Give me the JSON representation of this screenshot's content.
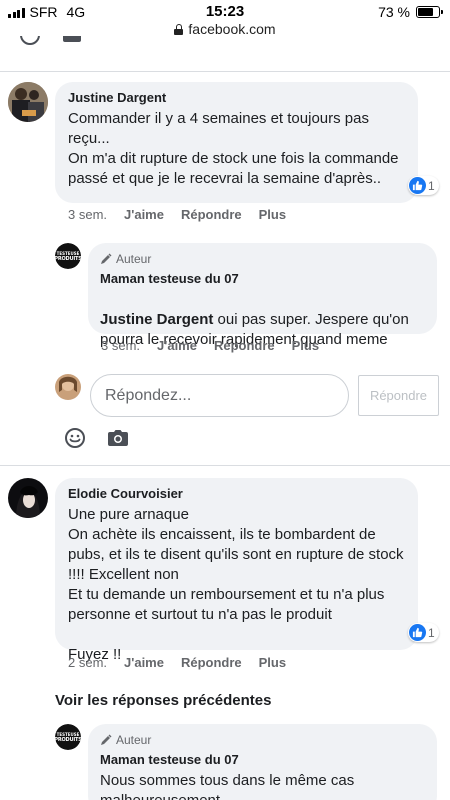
{
  "status_bar": {
    "carrier": "SFR",
    "network": "4G",
    "time": "15:23",
    "battery": "73 %",
    "battery_level": 0.73
  },
  "browser": {
    "url": "facebook.com"
  },
  "colors": {
    "accent": "#1877f2",
    "bubble_bg": "#f0f2f5",
    "meta_text": "#65676b"
  },
  "comments": [
    {
      "author": "Justine Dargent",
      "text": "Commander il y a 4 semaines et toujours pas reçu...\nOn m'a dit rupture de stock une fois la commande passé et que je le recevrai la semaine d'après..",
      "time": "3 sem.",
      "like_label": "J'aime",
      "reply_label": "Répondre",
      "more_label": "Plus",
      "likes": "1"
    },
    {
      "author": "Elodie Courvoisier",
      "text": "Une pure arnaque\nOn achète ils encaissent, ils te bombardent de pubs, et ils te disent qu'ils sont en rupture de stock !!!! Excellent non\nEt tu demande un remboursement et tu n'a plus personne et surtout tu n'a pas le produit\n\nFuyez !!",
      "time": "2 sem.",
      "like_label": "J'aime",
      "reply_label": "Répondre",
      "more_label": "Plus",
      "likes": "1"
    }
  ],
  "replies": [
    {
      "badge": "Auteur",
      "author": "Maman testeuse du 07",
      "mention": "Justine Dargent",
      "text": " oui pas super. Jespere qu'on pourra le recevoir rapidement quand meme",
      "time": "3 sem.",
      "like_label": "J'aime",
      "reply_label": "Répondre",
      "more_label": "Plus"
    },
    {
      "badge": "Auteur",
      "author": "Maman testeuse du 07",
      "text": "Nous sommes tous dans le même cas malheureusement"
    }
  ],
  "reply_box": {
    "placeholder": "Répondez...",
    "button": "Répondre"
  },
  "see_previous": "Voir les réponses précédentes",
  "icons": {
    "emoji": "smiley-icon",
    "camera": "camera-icon",
    "like": "thumbs-up-icon",
    "author_badge": "pencil-icon",
    "lock": "lock-icon"
  }
}
